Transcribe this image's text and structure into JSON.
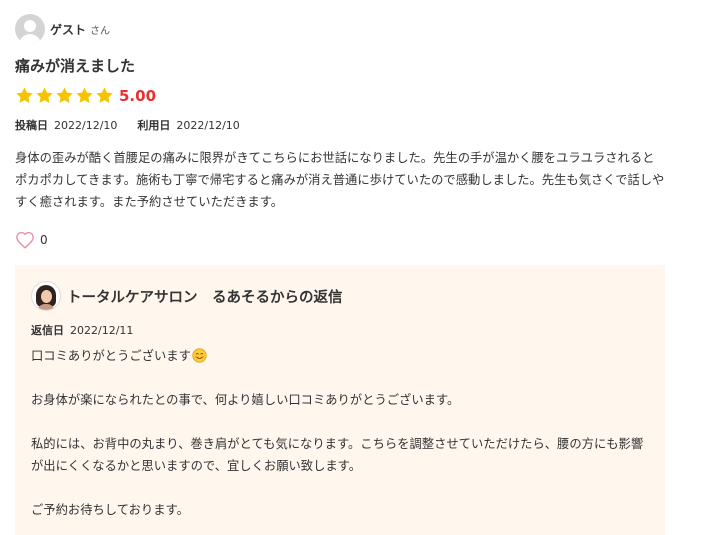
{
  "user": {
    "name": "ゲスト",
    "suffix": "さん"
  },
  "review": {
    "title": "痛みが消えました",
    "rating": {
      "stars": 5,
      "max": 5,
      "score": "5.00",
      "color": "#f5c400"
    },
    "posted_label": "投稿日",
    "posted_date": "2022/12/10",
    "used_label": "利用日",
    "used_date": "2022/12/10",
    "text": "身体の歪みが酷く首腰足の痛みに限界がきてこちらにお世話になりました。先生の手が温かく腰をユラユラされるとポカポカしてきます。施術も丁寧で帰宅すると痛みが消え普通に歩けていたので感動しました。先生も気さくで話しやすく癒されます。また予約させていただきます。",
    "like_icon": "heart-outline",
    "like_count": "0"
  },
  "reply": {
    "title": "トータルケアサロン　るあそるからの返信",
    "date_label": "返信日",
    "date": "2022/12/11",
    "lines": [
      "口コミありがとうございます",
      "",
      "お身体が楽になられたとの事で、何より嬉しい口コミありがとうございます。",
      "",
      "私的には、お背中の丸まり、巻き肩がとても気になります。こちらを調整させていただけたら、腰の方にも影響が出にくくなるかと思いますので、宜しくお願い致します。",
      "",
      "ご予約お待ちしております。"
    ],
    "background": "#fff6ee"
  },
  "colors": {
    "score": "#e8312f",
    "heart": "#e98a9c"
  }
}
